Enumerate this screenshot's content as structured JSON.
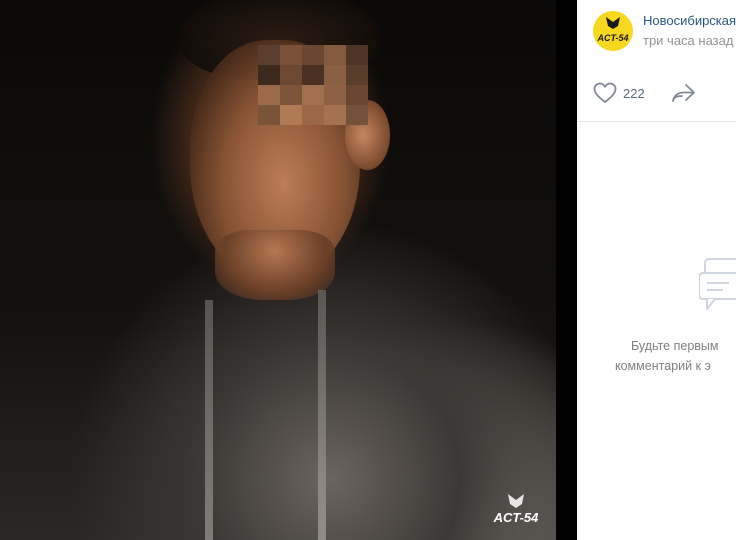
{
  "photo": {
    "watermark_text": "ACT-54"
  },
  "post": {
    "group_name": "Новосибирская",
    "time": "три часа назад",
    "avatar_text": "ACT-54",
    "likes": "222"
  },
  "comments": {
    "empty_line1": "Будьте первым",
    "empty_line2": "комментарий к э"
  },
  "icons": {
    "like": "heart-icon",
    "share": "share-arrow-icon",
    "comments_empty": "comment-bubbles-icon"
  },
  "colors": {
    "link": "#2a5885",
    "muted": "#939393",
    "avatar_bg": "#f7d81f"
  }
}
